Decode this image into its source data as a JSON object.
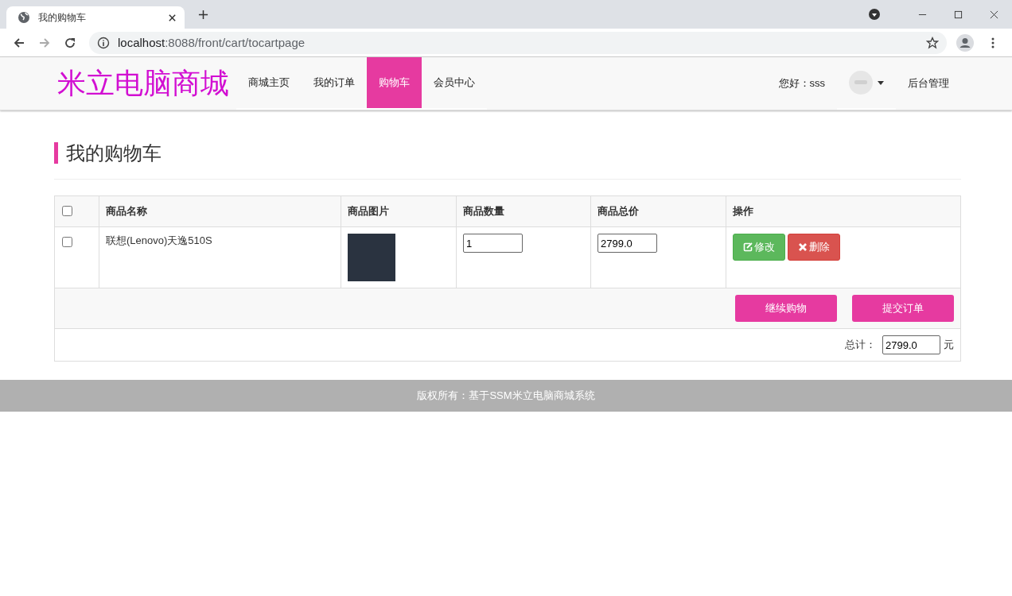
{
  "browser": {
    "tab_title": "我的购物车",
    "url_host": "localhost",
    "url_path": ":8088/front/cart/tocartpage"
  },
  "nav": {
    "brand": "米立电脑商城",
    "items": [
      {
        "label": "商城主页",
        "selected": false
      },
      {
        "label": "我的订单",
        "selected": false
      },
      {
        "label": "购物车",
        "selected": true
      },
      {
        "label": "会员中心",
        "selected": false
      }
    ],
    "greeting": "您好：sss",
    "admin": "后台管理"
  },
  "page_title": "我的购物车",
  "table": {
    "select_all": {
      "checked": false
    },
    "columns": [
      "商品名称",
      "商品图片",
      "商品数量",
      "商品总价",
      "操作"
    ],
    "rows": [
      {
        "checked": false,
        "name": "联想(Lenovo)天逸510S",
        "quantity": "1",
        "total": "2799.0",
        "edit": "修改",
        "delete": "删除"
      }
    ],
    "actions": [
      "继续购物",
      "提交订单"
    ],
    "total_label": "总计：",
    "total_value": "2799.0",
    "currency": "元"
  },
  "footer": "版权所有：基于SSM米立电脑商城系统"
}
